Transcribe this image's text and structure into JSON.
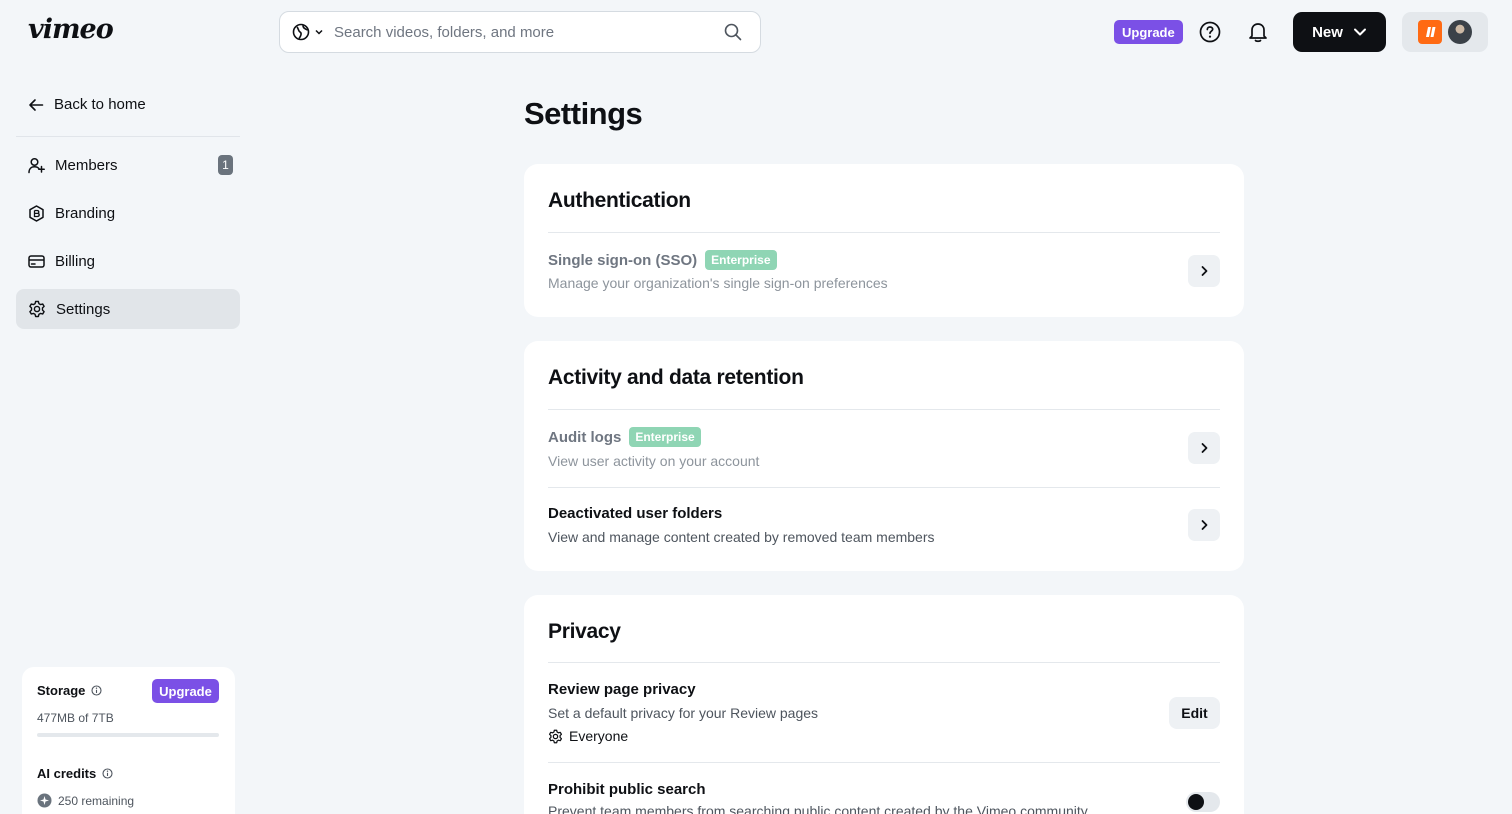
{
  "header": {
    "logo": "vimeo",
    "search_placeholder": "Search videos, folders, and more",
    "upgrade_label": "Upgrade",
    "new_label": "New"
  },
  "sidebar": {
    "back_label": "Back to home",
    "items": [
      {
        "label": "Members",
        "icon": "user-plus-icon",
        "badge": "1"
      },
      {
        "label": "Branding",
        "icon": "branding-icon"
      },
      {
        "label": "Billing",
        "icon": "credit-card-icon"
      },
      {
        "label": "Settings",
        "icon": "gear-icon",
        "active": true
      }
    ],
    "storage": {
      "title": "Storage",
      "upgrade_label": "Upgrade",
      "usage": "477MB of 7TB",
      "used_fraction": 0.0001
    },
    "ai_credits": {
      "title": "AI credits",
      "remaining": "250 remaining"
    }
  },
  "main": {
    "title": "Settings",
    "authentication": {
      "title": "Authentication",
      "sso_title": "Single sign-on (SSO)",
      "sso_tag": "Enterprise",
      "sso_desc": "Manage your organization's single sign-on preferences"
    },
    "activity": {
      "title": "Activity and data retention",
      "audit_title": "Audit logs",
      "audit_tag": "Enterprise",
      "audit_desc": "View user activity on your account",
      "deactivated_title": "Deactivated user folders",
      "deactivated_desc": "View and manage content created by removed team members"
    },
    "privacy": {
      "title": "Privacy",
      "review_title": "Review page privacy",
      "review_desc": "Set a default privacy for your Review pages",
      "review_value": "Everyone",
      "edit_label": "Edit",
      "prohibit_title": "Prohibit public search",
      "prohibit_desc": "Prevent team members from searching public content created by the Vimeo community"
    }
  },
  "colors": {
    "accent": "#7b50e6",
    "enterprise": "#8fd5b4",
    "background": "#f3f6f9",
    "dark": "#0e1014"
  }
}
